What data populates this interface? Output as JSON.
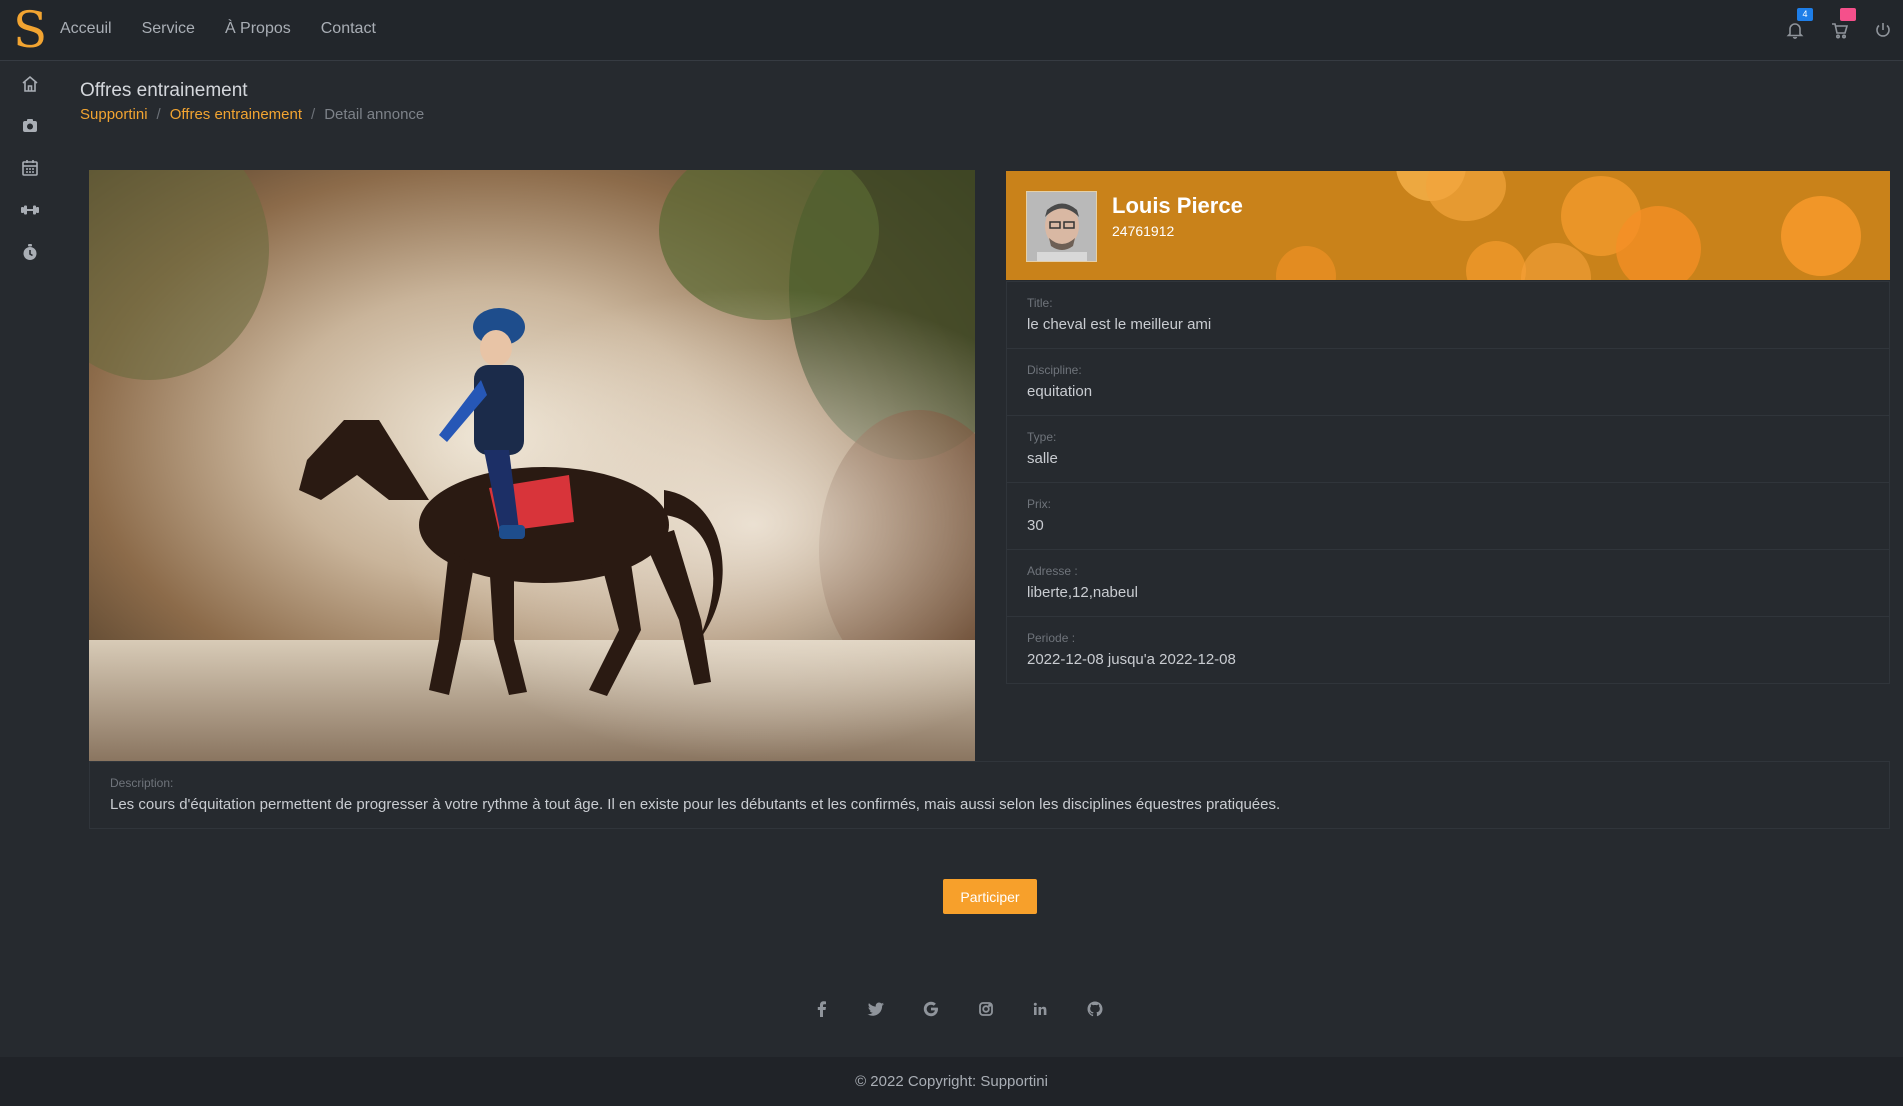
{
  "brand": {
    "logo_letter": "S"
  },
  "nav": {
    "links": [
      "Acceuil",
      "Service",
      "À Propos",
      "Contact"
    ],
    "notification_count": "4"
  },
  "sidebar": {
    "icons": [
      "home-icon",
      "camera-icon",
      "calendar-icon",
      "dumbbell-icon",
      "stopwatch-icon"
    ]
  },
  "page": {
    "title": "Offres entrainement",
    "breadcrumb": [
      "Supportini",
      "Offres entrainement",
      "Detail annonce"
    ]
  },
  "profile": {
    "name": "Louis Pierce",
    "id": "24761912"
  },
  "details": [
    {
      "label": "Title:",
      "value": "le cheval est le meilleur ami"
    },
    {
      "label": "Discipline:",
      "value": "equitation"
    },
    {
      "label": "Type:",
      "value": "salle"
    },
    {
      "label": "Prix:",
      "value": "30"
    },
    {
      "label": "Adresse :",
      "value": "liberte,12,nabeul"
    },
    {
      "label": "Periode :",
      "value": "2022-12-08 jusqu'a 2022-12-08"
    }
  ],
  "description": {
    "label": "Description:",
    "text": "Les cours d'équitation permettent de progresser à votre rythme à tout âge. Il en existe pour les débutants et les confirmés, mais aussi selon les disciplines équestres pratiquées."
  },
  "actions": {
    "participate_label": "Participer"
  },
  "social": [
    "facebook-icon",
    "twitter-icon",
    "google-icon",
    "instagram-icon",
    "linkedin-icon",
    "github-icon"
  ],
  "footer": {
    "copyright": "© 2022 Copyright: Supportini"
  },
  "colors": {
    "accent": "#f2a431",
    "background": "#262a2f",
    "profile_banner": "#c9821a"
  }
}
